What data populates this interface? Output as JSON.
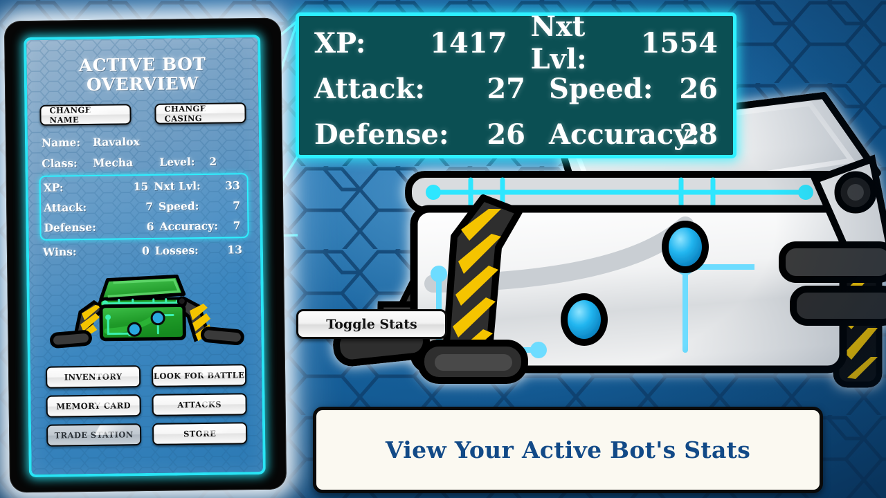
{
  "theme": {
    "accent_cyan": "#2ef0ff",
    "panel_teal": "#0b4f53",
    "caption_blue": "#124a87",
    "bg_blue": "#1d6db5",
    "bot_green": "#21a02a",
    "hazard_yellow": "#f5c400"
  },
  "device": {
    "panel_title_line1": "ACTIVE BOT",
    "panel_title_line2": "OVERVIEW",
    "top_buttons": [
      {
        "label": "CHANGE NAME",
        "name": "change-name-button"
      },
      {
        "label": "CHANGE CASING",
        "name": "change-casing-button"
      }
    ],
    "identity": {
      "name_label": "Name:",
      "name_value": "Ravalox",
      "class_label": "Class:",
      "class_value": "Mecha",
      "level_label": "Level:",
      "level_value": "2"
    },
    "stats": {
      "xp_label": "XP:",
      "xp_value": "15",
      "nxt_lvl_label": "Nxt Lvl:",
      "nxt_lvl_value": "33",
      "attack_label": "Attack:",
      "attack_value": "7",
      "speed_label": "Speed:",
      "speed_value": "7",
      "defense_label": "Defense:",
      "defense_value": "6",
      "accuracy_label": "Accuracy:",
      "accuracy_value": "7"
    },
    "record": {
      "wins_label": "Wins:",
      "wins_value": "0",
      "losses_label": "Losses:",
      "losses_value": "13"
    },
    "avatar_name": "bot-avatar-green-mecha",
    "menu_buttons": [
      {
        "label": "INVENTORY",
        "name": "inventory-button",
        "disabled": false
      },
      {
        "label": "LOOK FOR BATTLE",
        "name": "look-for-battle-button",
        "disabled": false
      },
      {
        "label": "MEMORY CARD",
        "name": "memory-card-button",
        "disabled": false
      },
      {
        "label": "ATTACKS",
        "name": "attacks-button",
        "disabled": false
      },
      {
        "label": "TRADE STATION",
        "name": "trade-station-button",
        "disabled": true
      },
      {
        "label": "STORE",
        "name": "store-button",
        "disabled": false
      }
    ]
  },
  "callout": {
    "xp_label": "XP:",
    "xp_value": "1417",
    "nxt_lvl_label": "Nxt Lvl:",
    "nxt_lvl_value": "1554",
    "attack_label": "Attack:",
    "attack_value": "27",
    "speed_label": "Speed:",
    "speed_value": "26",
    "defense_label": "Defense:",
    "defense_value": "26",
    "accuracy_label": "Accuracy:",
    "accuracy_value": "28"
  },
  "toggle_stats_label": "Toggle Stats",
  "caption_text": "View Your Active Bot's Stats"
}
